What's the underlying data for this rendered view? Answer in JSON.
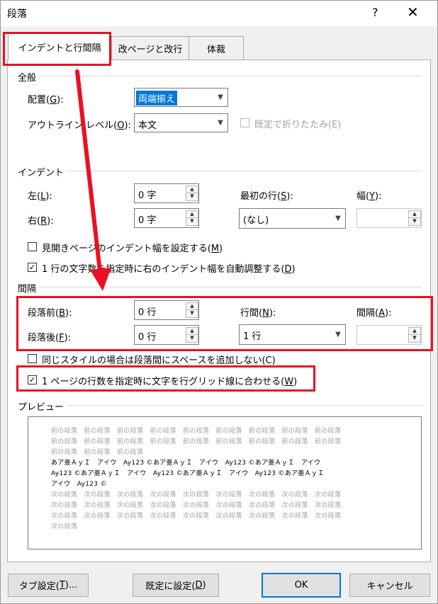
{
  "window": {
    "title": "段落",
    "help": "?",
    "close": "✕"
  },
  "tabs": [
    {
      "label": "インデントと行間隔"
    },
    {
      "label": "改ページと改行"
    },
    {
      "label": "体裁"
    }
  ],
  "general": {
    "section": "全般",
    "alignment_label_pre": "配置(",
    "alignment_key": "G",
    "alignment_label_post": "):",
    "alignment_value": "両端揃え",
    "outline_label_pre": "アウトライン レベル(",
    "outline_key": "O",
    "outline_label_post": "):",
    "outline_value": "本文",
    "collapse_label": "既定で折りたたみ(E)"
  },
  "indent": {
    "section": "インデント",
    "left_label_pre": "左(",
    "left_key": "L",
    "left_label_post": "):",
    "left_value": "0 字",
    "right_label_pre": "右(",
    "right_key": "R",
    "right_label_post": "):",
    "right_value": "0 字",
    "first_line_label_pre": "最初の行(",
    "first_line_key": "S",
    "first_line_label_post": "):",
    "first_line_value": "(なし)",
    "width_label_pre": "幅(",
    "width_key": "Y",
    "width_label_post": "):",
    "width_value": "",
    "mirror_label_pre": "見開きページのインデント幅を設定する(",
    "mirror_key": "M",
    "mirror_label_post": ")",
    "auto_adjust_label_pre": "1 行の文字数を指定時に右のインデント幅を自動調整する(",
    "auto_adjust_key": "D",
    "auto_adjust_label_post": ")"
  },
  "spacing": {
    "section": "間隔",
    "before_label_pre": "段落前(",
    "before_key": "B",
    "before_label_post": "):",
    "before_value": "0 行",
    "after_label_pre": "段落後(",
    "after_key": "F",
    "after_label_post": "):",
    "after_value": "0 行",
    "line_spacing_label_pre": "行間(",
    "line_spacing_key": "N",
    "line_spacing_label_post": "):",
    "line_spacing_value": "1 行",
    "at_label_pre": "間隔(",
    "at_key": "A",
    "at_label_post": "):",
    "at_value": "",
    "same_style_label": "同じスタイルの場合は段落間にスペースを追加しない(C)",
    "grid_label_pre": "1 ページの行数を指定時に文字を行グリッド線に合わせる(",
    "grid_key": "W",
    "grid_label_post": ")"
  },
  "preview": {
    "section": "プレビュー",
    "prev_lines": [
      "前の段落　前の段落　前の段落　前の段落　前の段落　前の段落　前の段落　前の段落　前の段落",
      "前の段落　前の段落　前の段落　前の段落　前の段落　前の段落　前の段落　前の段落　前の段落",
      "前の段落　前の段落　前の段落"
    ],
    "sample_lines": [
      "あア亜ＡｙＩ　アイウ　Ay123 ©あア亜ＡｙＩ　アイウ　Ay123 ©あア亜ＡｙＩ　アイウ",
      "Ay123 ©あア亜ＡｙＩ　アイウ　Ay123 ©あア亜ＡｙＩ　アイウ　Ay123 ©あア亜ＡｙＩ",
      "アイウ　Ay123 ©"
    ],
    "next_lines": [
      "次の段落　次の段落　次の段落　次の段落　次の段落　次の段落　次の段落　次の段落　次の段落",
      "次の段落　次の段落　次の段落　次の段落　次の段落　次の段落　次の段落　次の段落　次の段落",
      "次の段落　次の段落　次の段落　次の段落　次の段落　次の段落　次の段落　次の段落　次の段落",
      "次の段落"
    ]
  },
  "buttons": {
    "tabs_pre": "タブ設定(",
    "tabs_key": "T",
    "tabs_post": ")...",
    "default_pre": "既定に設定(",
    "default_key": "D",
    "default_post": ")",
    "ok": "OK",
    "cancel": "キャンセル"
  },
  "colors": {
    "highlight": "#e81123",
    "selection": "#0078d7"
  }
}
